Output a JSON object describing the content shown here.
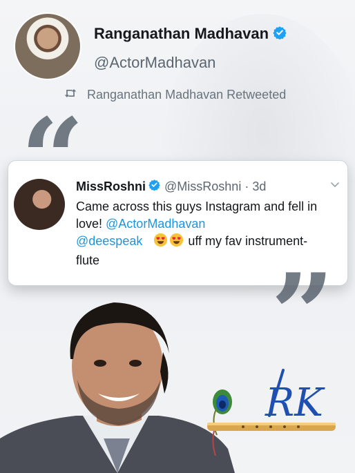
{
  "retweeter": {
    "name": "Ranganathan Madhavan",
    "handle": "@ActorMadhavan",
    "retweeted_label": "Ranganathan Madhavan Retweeted"
  },
  "tweet": {
    "name": "MissRoshni",
    "handle": "@MissRoshni",
    "separator": "·",
    "time": "3d",
    "text_part1": "Came across this guys Instagram and fell in love! ",
    "mention1": "@ActorMadhavan",
    "mention2": "@deespeak",
    "text_part2": " uff my fav instrument- flute"
  },
  "logo_letters": "RK",
  "colors": {
    "verified": "#1da1f2",
    "mention": "#1b95e0",
    "logo_blue": "#1f4fb0"
  },
  "icons": [
    "verified-badge-icon",
    "retweet-icon",
    "chevron-down-icon",
    "heart-eyes-emoji-icon",
    "flute-icon",
    "peacock-feather-icon"
  ]
}
